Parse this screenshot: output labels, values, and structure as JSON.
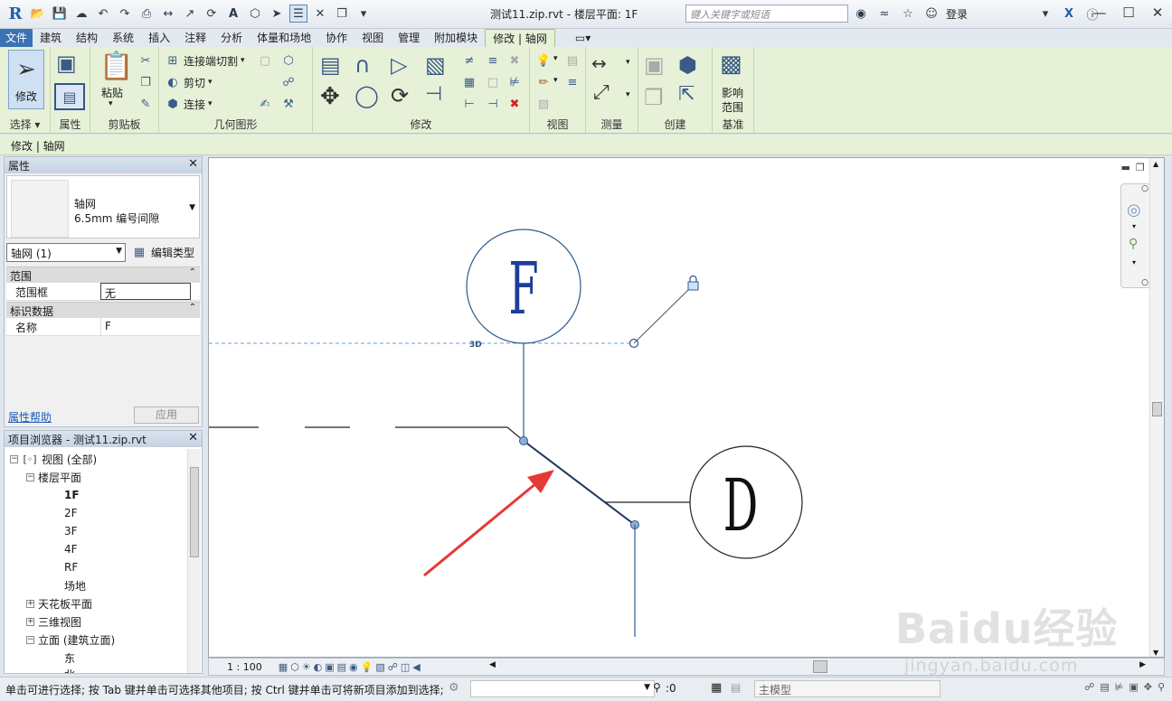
{
  "titlebar": {
    "app_logo": "R",
    "title": "测试11.zip.rvt - 楼层平面: 1F",
    "search_placeholder": "键入关键字或短语",
    "login": "登录"
  },
  "tabs": [
    "文件",
    "建筑",
    "结构",
    "系统",
    "插入",
    "注释",
    "分析",
    "体量和场地",
    "协作",
    "视图",
    "管理",
    "附加模块",
    "修改 | 轴网"
  ],
  "active_tab": "修改 | 轴网",
  "ribbon": {
    "panels": {
      "select": "选择",
      "properties": "属性",
      "clipboard": "剪贴板",
      "geometry": "几何图形",
      "modify": "修改",
      "view": "视图",
      "measure": "测量",
      "create": "创建",
      "datum": "基准"
    },
    "modify_button": "修改",
    "paste_button": "粘贴",
    "geometry_items": [
      "连接端切割",
      "剪切",
      "连接"
    ],
    "scope_box_label_1": "影响",
    "scope_box_label_2": "范围"
  },
  "context_bar": "修改 | 轴网",
  "properties": {
    "header": "属性",
    "type_name_1": "轴网",
    "type_name_2": "6.5mm 编号间隙",
    "instance_selector": "轴网 (1)",
    "edit_type": "编辑类型",
    "groups": [
      {
        "name": "范围",
        "rows": [
          {
            "key": "范围框",
            "value": "无"
          }
        ]
      },
      {
        "name": "标识数据",
        "rows": [
          {
            "key": "名称",
            "value": "F"
          }
        ]
      }
    ],
    "help_link": "属性帮助",
    "apply": "应用"
  },
  "browser": {
    "header": "项目浏览器 - 测试11.zip.rvt",
    "nodes": {
      "views_all": "视图 (全部)",
      "floor_plans": "楼层平面",
      "floor_items": [
        "1F",
        "2F",
        "3F",
        "4F",
        "RF",
        "场地"
      ],
      "ceiling_plans": "天花板平面",
      "views_3d": "三维视图",
      "elevations": "立面 (建筑立面)",
      "elev_east": "东",
      "elev_north": "北"
    }
  },
  "canvas": {
    "grid_f_label": "F",
    "grid_d_label": "D",
    "badge_3d": "3D"
  },
  "viewbar": {
    "scale": "1 : 100"
  },
  "statusbar": {
    "text": "单击可进行选择; 按 Tab 键并单击可选择其他项目; 按 Ctrl 键并单击可将新项目添加到选择;",
    "filter_count": ":0",
    "model": "主模型"
  },
  "watermark": {
    "logo": "Baidu经验",
    "url": "jingyan.baidu.com"
  },
  "colors": {
    "accent": "#3b72b4",
    "ribbon_bg": "#e6f1d8",
    "grid_line": "#2b5a8a",
    "arrow": "#e53935"
  }
}
